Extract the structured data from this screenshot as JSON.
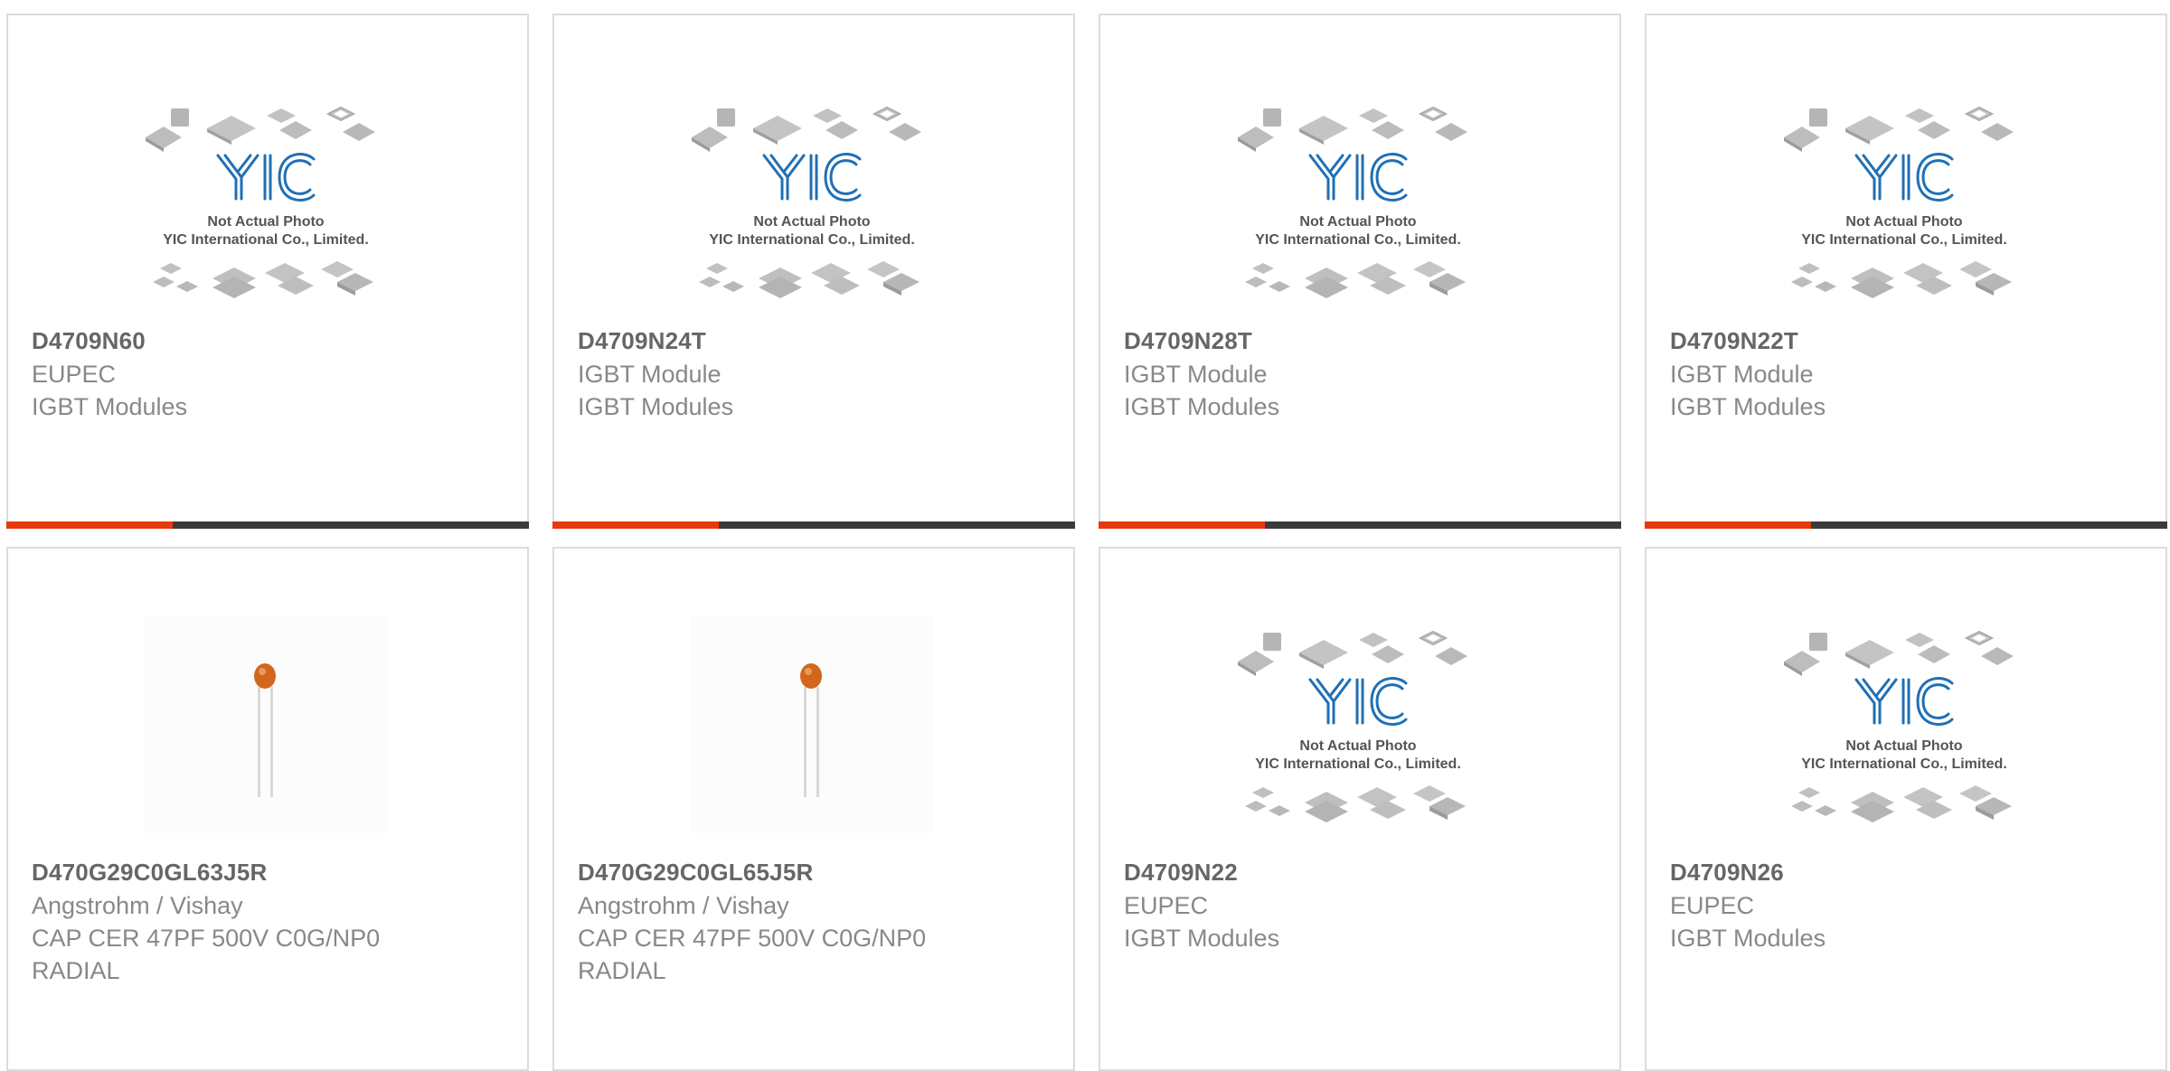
{
  "placeholder": {
    "logo": "YIC",
    "line1": "Not Actual Photo",
    "line2": "YIC International Co., Limited."
  },
  "products": [
    {
      "part": "D4709N60",
      "brand": "EUPEC",
      "description": "IGBT Modules",
      "image": "placeholder"
    },
    {
      "part": "D4709N24T",
      "brand": "IGBT Module",
      "description": "IGBT Modules",
      "image": "placeholder"
    },
    {
      "part": "D4709N28T",
      "brand": "IGBT Module",
      "description": "IGBT Modules",
      "image": "placeholder"
    },
    {
      "part": "D4709N22T",
      "brand": "IGBT Module",
      "description": "IGBT Modules",
      "image": "placeholder"
    },
    {
      "part": "D470G29C0GL63J5R",
      "brand": "Angstrohm / Vishay",
      "description": "CAP CER 47PF 500V C0G/NP0",
      "description2": "RADIAL",
      "image": "capacitor-photo"
    },
    {
      "part": "D470G29C0GL65J5R",
      "brand": "Angstrohm / Vishay",
      "description": "CAP CER 47PF 500V C0G/NP0",
      "description2": "RADIAL",
      "image": "capacitor-photo"
    },
    {
      "part": "D4709N22",
      "brand": "EUPEC",
      "description": "IGBT Modules",
      "image": "placeholder"
    },
    {
      "part": "D4709N26",
      "brand": "EUPEC",
      "description": "IGBT Modules",
      "image": "placeholder"
    }
  ],
  "colors": {
    "accent": "#e8380d",
    "bar": "#3b3b3b",
    "logo": "#1f6fb5",
    "title": "#666666",
    "text": "#888888"
  }
}
